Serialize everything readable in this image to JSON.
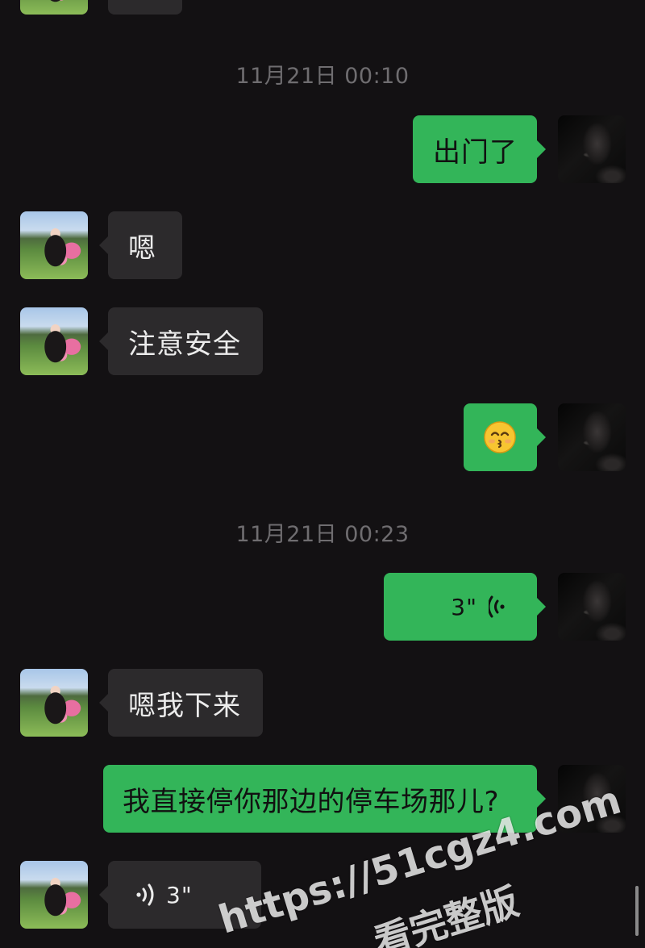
{
  "timestamps": [
    "11月21日 00:10",
    "11月21日 00:23"
  ],
  "messages": {
    "m_top_partial": "",
    "m1": "出门了",
    "m2": "嗯",
    "m3": "注意安全",
    "m4_icon": "kissing-face-emoji",
    "m5_duration": "3\"",
    "m6": "嗯我下来",
    "m7": "我直接停你那边的停车场那儿?",
    "m8_duration": "3\""
  },
  "watermark": {
    "url": "https://51cgz4.com",
    "text": "看完整版"
  },
  "colors": {
    "background": "#131113",
    "incoming_bubble": "#2c2a2c",
    "outgoing_bubble": "#33b559",
    "timestamp": "#6f6d70"
  }
}
